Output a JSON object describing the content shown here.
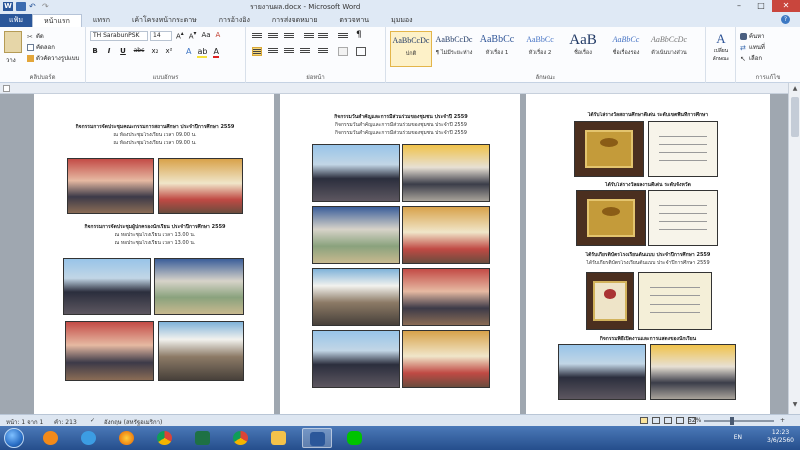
{
  "window": {
    "title": "รายงานผล.docx - Microsoft Word",
    "minimize": "–",
    "maximize": "□",
    "close": "✕"
  },
  "ribbon_tabs": [
    "หน้าแรก",
    "แทรก",
    "เค้าโครงหน้ากระดาษ",
    "การอ้างอิง",
    "การส่งจดหมาย",
    "ตรวจทาน",
    "มุมมอง"
  ],
  "file_tab": "แฟ้ม",
  "clipboard": {
    "paste_label": "วาง",
    "cut": "ตัด",
    "copy": "คัดลอก",
    "format_painter": "ตัวคัดวางรูปแบบ",
    "group_label": "คลิปบอร์ด"
  },
  "font": {
    "name": "TH SarabunPSK",
    "size": "14",
    "bold": "B",
    "italic": "I",
    "underline": "U",
    "strike": "abc",
    "subscript": "x₂",
    "superscript": "x²",
    "group_label": "แบบอักษร"
  },
  "paragraph": {
    "group_label": "ย่อหน้า"
  },
  "styles": {
    "items": [
      {
        "sample": "AaBbCcDc",
        "name": "ปกติ"
      },
      {
        "sample": "AaBbCcDc",
        "name": "¶ ไม่มีระยะห่าง"
      },
      {
        "sample": "AaBbCc",
        "name": "หัวเรื่อง 1"
      },
      {
        "sample": "AaBbCc",
        "name": "หัวเรื่อง 2"
      },
      {
        "sample": "AaB",
        "name": "ชื่อเรื่อง"
      },
      {
        "sample": "AaBbCc",
        "name": "ชื่อเรื่องรอง"
      },
      {
        "sample": "AaBbCcDc",
        "name": "ตัวเน้นบางส่วน"
      }
    ],
    "change_label": "เปลี่ยนลักษณะ",
    "group_label": "ลักษณะ"
  },
  "editing": {
    "find": "ค้นหา",
    "replace": "แทนที่",
    "select": "เลือก",
    "group_label": "การแก้ไข"
  },
  "status": {
    "page": "หน้า: 1 จาก 1",
    "words": "คำ: 213",
    "language": "อังกฤษ (สหรัฐอเมริกา)",
    "zoom": "52%"
  },
  "tray": {
    "lang": "EN",
    "time": "12:23",
    "date": "3/6/2560"
  },
  "document": {
    "p1_caption1": "กิจกรรมการจัดประชุมคณะกรรมการสถานศึกษา ประจำปีการศึกษา 2559",
    "p1_caption1b": "ณ ห้องประชุมโรงเรียน เวลา 09.00 น.",
    "p1_caption2": "กิจกรรมการจัดประชุมผู้ปกครองนักเรียน ประจำปีการศึกษา 2559",
    "p1_caption2b": "ณ หอประชุมโรงเรียน เวลา 13.00 น.",
    "p2_caption": "กิจกรรมวันสำคัญและการมีส่วนร่วมของชุมชน ประจำปี 2559",
    "p3_caption1": "ได้รับโล่รางวัลสถานศึกษาดีเด่น ระดับเขตพื้นที่การศึกษา",
    "p3_caption2": "ได้รับโล่รางวัลผลงานดีเด่น ระดับจังหวัด",
    "p3_caption3": "ได้รับเกียรติบัตรโรงเรียนต้นแบบ ประจำปีการศึกษา 2559",
    "p3_caption4": "กิจกรรมพิธีเปิดงานและการแสดงของนักเรียน"
  }
}
